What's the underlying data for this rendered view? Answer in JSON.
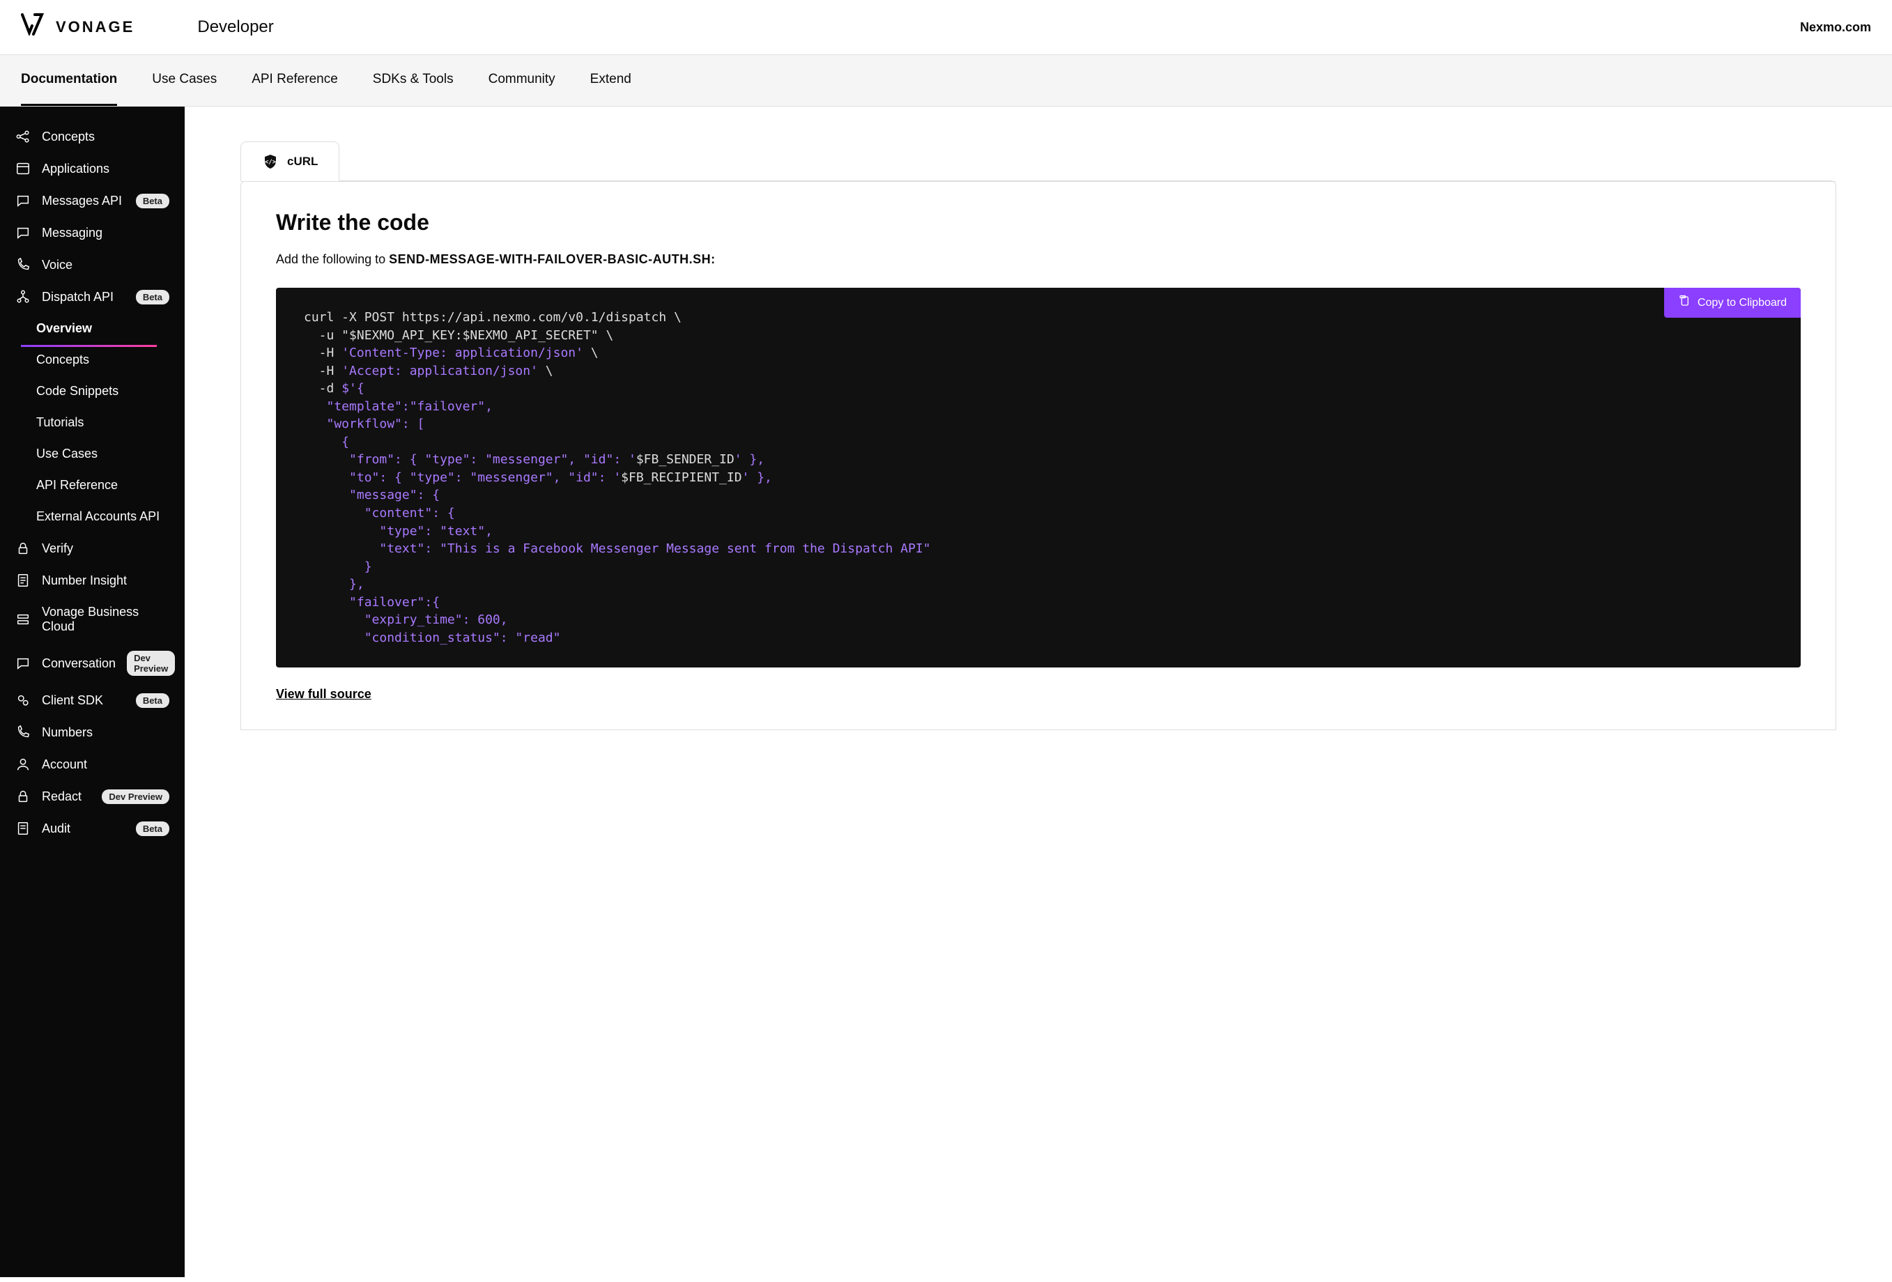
{
  "header": {
    "brand": "VONAGE",
    "sub": "Developer",
    "right_link": "Nexmo.com"
  },
  "nav": {
    "items": [
      "Documentation",
      "Use Cases",
      "API Reference",
      "SDKs & Tools",
      "Community",
      "Extend"
    ],
    "active": "Documentation"
  },
  "sidebar": {
    "items": [
      {
        "label": "Concepts",
        "icon": "share"
      },
      {
        "label": "Applications",
        "icon": "window"
      },
      {
        "label": "Messages API",
        "icon": "chat",
        "badge": "Beta"
      },
      {
        "label": "Messaging",
        "icon": "chat"
      },
      {
        "label": "Voice",
        "icon": "phone"
      },
      {
        "label": "Dispatch API",
        "icon": "tree",
        "badge": "Beta",
        "expanded": true
      }
    ],
    "sub_items": [
      "Overview",
      "Concepts",
      "Code Snippets",
      "Tutorials",
      "Use Cases",
      "API Reference",
      "External Accounts API"
    ],
    "sub_active": "Overview",
    "items_after": [
      {
        "label": "Verify",
        "icon": "lock"
      },
      {
        "label": "Number Insight",
        "icon": "doc"
      },
      {
        "label": "Vonage Business Cloud",
        "icon": "stack"
      },
      {
        "label": "Conversation",
        "icon": "chat",
        "badge": "Dev Preview"
      },
      {
        "label": "Client SDK",
        "icon": "gears",
        "badge": "Beta"
      },
      {
        "label": "Numbers",
        "icon": "phone2"
      },
      {
        "label": "Account",
        "icon": "user"
      },
      {
        "label": "Redact",
        "icon": "lock",
        "badge": "Dev Preview"
      },
      {
        "label": "Audit",
        "icon": "doc",
        "badge": "Beta"
      }
    ]
  },
  "main": {
    "tab_label": "cURL",
    "heading": "Write the code",
    "instruction_prefix": "Add the following to ",
    "instruction_file": "SEND-MESSAGE-WITH-FAILOVER-BASIC-AUTH.SH:",
    "copy_label": "Copy to Clipboard",
    "view_source": "View full source",
    "code": {
      "l1a": "curl -X POST https://api.nexmo.com/v0.1/dispatch \\",
      "l2a": "  -u \"$NEXMO_API_KEY:$NEXMO_API_SECRET\" \\",
      "l3a": "  -H ",
      "l3b": "'Content-Type: application/json'",
      "l3c": " \\",
      "l4a": "  -H ",
      "l4b": "'Accept: application/json'",
      "l4c": " \\",
      "l5a": "  -d ",
      "l5b": "$'{",
      "l6": "   \"template\":\"failover\",",
      "l7": "   \"workflow\": [",
      "l8": "     {",
      "l9a": "      \"from\": { \"type\": \"messenger\", \"id\": '",
      "l9b": "$FB_SENDER_ID",
      "l9c": "' },",
      "l10a": "      \"to\": { \"type\": \"messenger\", \"id\": '",
      "l10b": "$FB_RECIPIENT_ID",
      "l10c": "' },",
      "l11": "      \"message\": {",
      "l12": "        \"content\": {",
      "l13": "          \"type\": \"text\",",
      "l14": "          \"text\": \"This is a Facebook Messenger Message sent from the Dispatch API\"",
      "l15": "        }",
      "l16": "      },",
      "l17": "      \"failover\":{",
      "l18": "        \"expiry_time\": 600,",
      "l19": "        \"condition_status\": \"read\""
    }
  }
}
